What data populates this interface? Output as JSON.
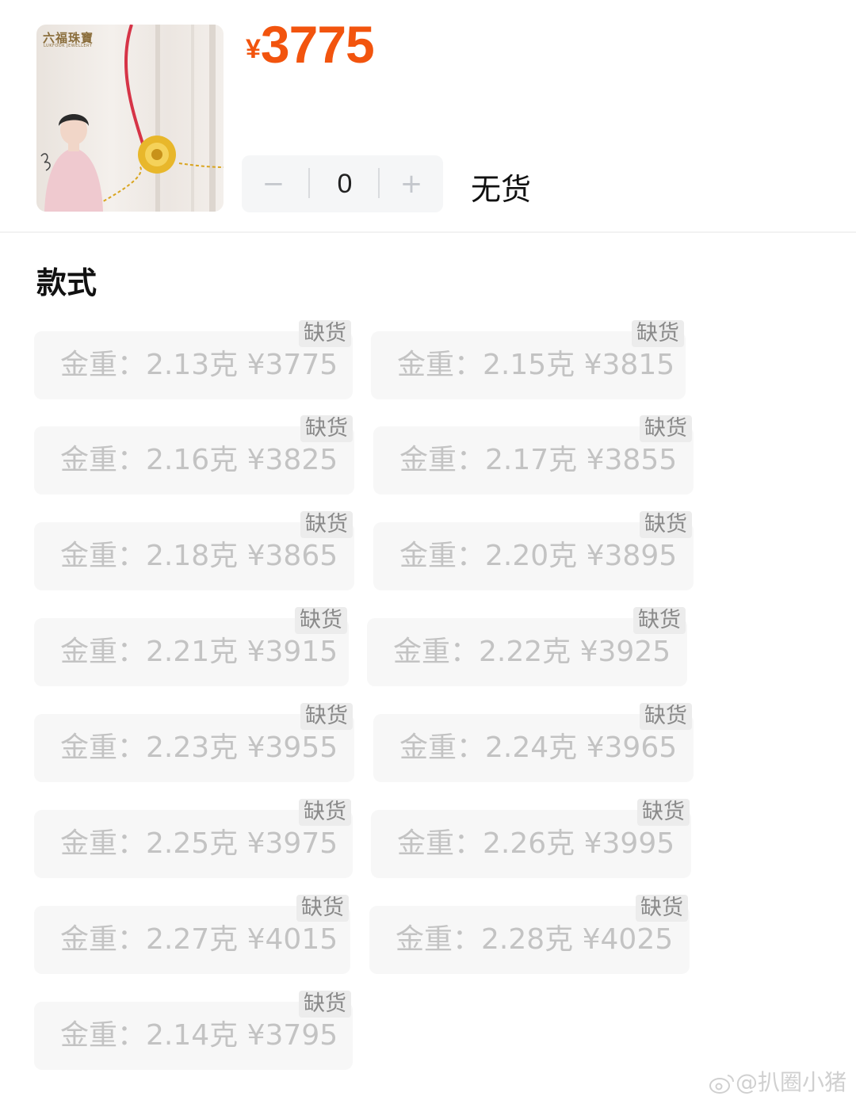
{
  "product": {
    "image_brand": "六福珠寶",
    "image_brand_en": "LUKFOOK JEWELLERY",
    "price_symbol": "¥",
    "price": "3775"
  },
  "stepper": {
    "minus": "−",
    "quantity": "0",
    "plus": "+"
  },
  "stock_status": "无货",
  "section_title": "款式",
  "options": [
    {
      "label": "金重：2.13克  ¥3775",
      "tag": "缺货"
    },
    {
      "label": "金重：2.15克  ¥3815",
      "tag": "缺货"
    },
    {
      "label": "金重：2.16克  ¥3825",
      "tag": "缺货"
    },
    {
      "label": "金重：2.17克  ¥3855",
      "tag": "缺货"
    },
    {
      "label": "金重：2.18克  ¥3865",
      "tag": "缺货"
    },
    {
      "label": "金重：2.20克  ¥3895",
      "tag": "缺货"
    },
    {
      "label": "金重：2.21克  ¥3915",
      "tag": "缺货"
    },
    {
      "label": "金重：2.22克  ¥3925",
      "tag": "缺货"
    },
    {
      "label": "金重：2.23克  ¥3955",
      "tag": "缺货"
    },
    {
      "label": "金重：2.24克  ¥3965",
      "tag": "缺货"
    },
    {
      "label": "金重：2.25克  ¥3975",
      "tag": "缺货"
    },
    {
      "label": "金重：2.26克  ¥3995",
      "tag": "缺货"
    },
    {
      "label": "金重：2.27克  ¥4015",
      "tag": "缺货"
    },
    {
      "label": "金重：2.28克  ¥4025",
      "tag": "缺货"
    },
    {
      "label": "金重：2.14克  ¥3795",
      "tag": "缺货"
    }
  ],
  "watermark": "@扒圈小猪",
  "colors": {
    "price": "#f2540e",
    "option_bg": "#f7f7f7",
    "option_text": "#c3c3c3"
  }
}
